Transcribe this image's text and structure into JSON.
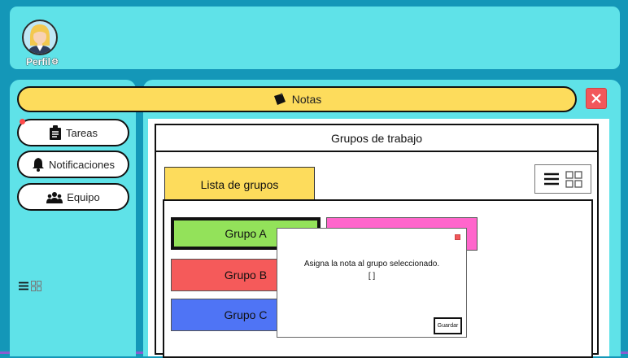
{
  "header": {
    "profile_label": "Perfil"
  },
  "notes_bar": {
    "label": "Notas"
  },
  "sidebar": {
    "items": [
      {
        "label": "Tareas"
      },
      {
        "label": "Notificaciones"
      },
      {
        "label": "Equipo"
      }
    ]
  },
  "panel": {
    "title": "Grupos de trabajo",
    "tab_label": "Lista de grupos",
    "groups": [
      {
        "label": "Grupo A",
        "color": "#93e25a"
      },
      {
        "label": "Grupo B",
        "color": "#f55a5a"
      },
      {
        "label": "Grupo C",
        "color": "#4f74f5"
      },
      {
        "label": "",
        "color": "#ff66cc"
      }
    ]
  },
  "modal": {
    "message": "Asigna la nota al grupo seleccionado.",
    "value": "[   ]",
    "save_label": "Guardar"
  },
  "colors": {
    "background": "#1497b8",
    "panel": "#5fe2e8",
    "accent_yellow": "#fddc5c",
    "close_red": "#f2575b"
  },
  "icons": [
    "settings-gear-icon",
    "clipboard-icon",
    "bell-icon",
    "team-icon",
    "sticky-note-icon",
    "close-icon",
    "list-view-icon",
    "grid-view-icon"
  ]
}
